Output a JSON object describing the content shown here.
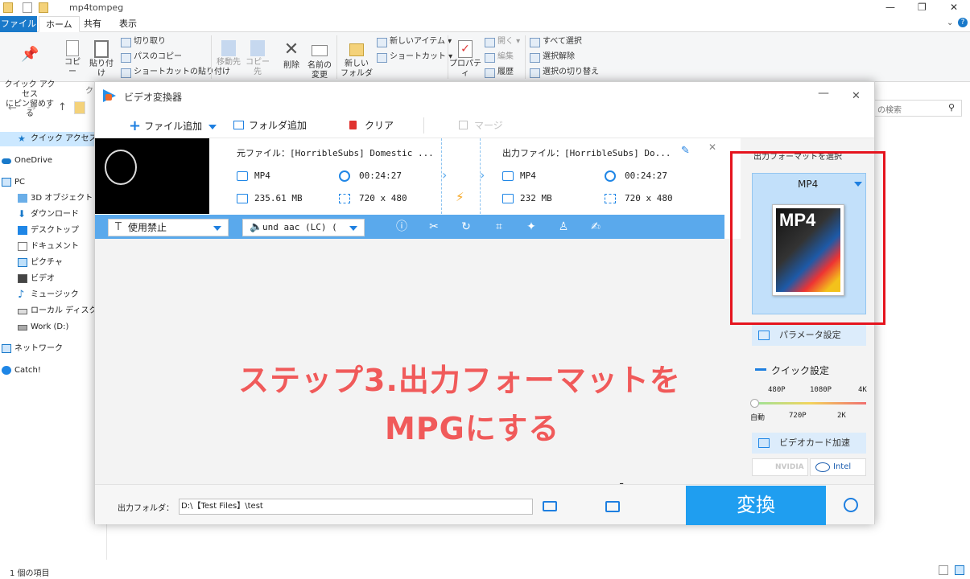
{
  "explorer": {
    "title": "mp4tompeg",
    "tabs": {
      "file": "ファイル",
      "home": "ホーム",
      "share": "共有",
      "view": "表示"
    },
    "ribbon": {
      "pin_quick_access": "クイック アクセス\nにピン留めする",
      "copy": "コピー",
      "paste": "貼り付け",
      "cut": "切り取り",
      "copy_path": "パスのコピー",
      "paste_shortcut": "ショートカットの貼り付け",
      "clipboard_group_fragment": "ク",
      "move_to": "移動先",
      "copy_to": "コピー先",
      "delete": "削除",
      "rename_line1": "名前の",
      "rename_line2": "変更",
      "new_folder_line1": "新しい",
      "new_folder_line2": "フォルダー",
      "new_item": "新しいアイテム ▾",
      "shortcut": "ショートカット ▾",
      "properties": "プロパティ",
      "open": "開く ▾",
      "edit": "編集",
      "history": "履歴",
      "select_all": "すべて選択",
      "select_none": "選択解除",
      "invert_selection": "選択の切り替え"
    },
    "search_placeholder": "の検索",
    "nav": {
      "quick_access": "クイック アクセス",
      "onedrive": "OneDrive",
      "pc": "PC",
      "objects3d": "3D オブジェクト",
      "downloads": "ダウンロード",
      "desktop": "デスクトップ",
      "documents": "ドキュメント",
      "pictures": "ピクチャ",
      "videos": "ビデオ",
      "music": "ミュージック",
      "local_disk": "ローカル ディスク (C",
      "work": "Work (D:)",
      "network": "ネットワーク",
      "catch": "Catch!"
    },
    "status": "1 個の項目"
  },
  "app": {
    "title": "ビデオ変換器",
    "toolbar": {
      "add_file": "ファイル追加",
      "add_folder": "フォルダ追加",
      "clear": "クリア",
      "merge": "マージ"
    },
    "file": {
      "source_label": "元ファイル：[HorribleSubs] Domestic ...",
      "source_format": "MP4",
      "source_duration": "00:24:27",
      "source_size": "235.61 MB",
      "source_resolution": "720 x 480",
      "output_label": "出力ファイル：[HorribleSubs] Do...",
      "output_format": "MP4",
      "output_duration": "00:24:27",
      "output_size": "232 MB",
      "output_resolution": "720 x 480"
    },
    "subtitle_select": "使用禁止",
    "audio_select": "und aac (LC) (",
    "caption_line1": "ステップ3.出力フォーマットを",
    "caption_line2": "MPGにする",
    "right": {
      "format_header": "出力フォーマットを選択",
      "format_value": "MP4",
      "param_settings": "パラメータ設定",
      "quick_settings": "クイック設定",
      "quality_top": [
        "480P",
        "1080P",
        "4K"
      ],
      "quality_bottom": [
        "自動",
        "720P",
        "2K"
      ],
      "quality_level": 0,
      "gpu_accel": "ビデオカード加速",
      "nvidia": "NVIDIA",
      "intel": "Intel"
    },
    "output_folder_label": "出力フォルダ：",
    "output_folder_path": "D:\\【Test Files】\\test",
    "convert": "変換"
  }
}
